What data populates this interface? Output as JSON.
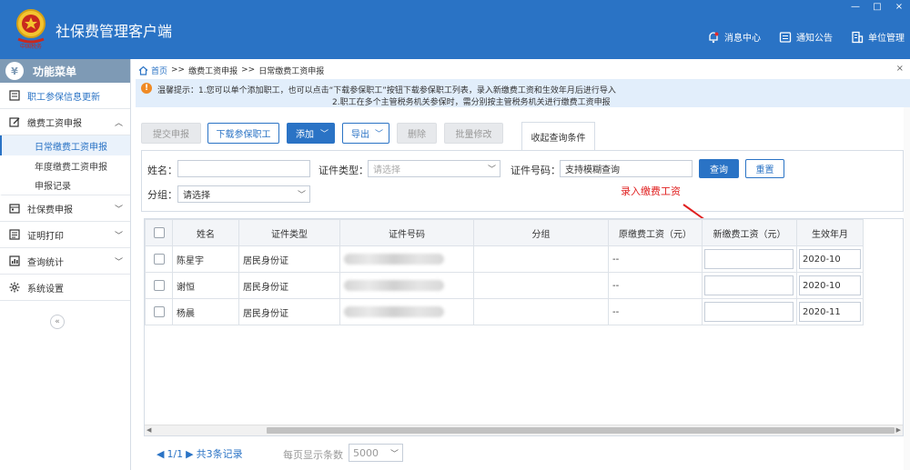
{
  "app": {
    "title": "社保费管理客户端",
    "window_controls": [
      "—",
      "□",
      "×"
    ],
    "header_menu": [
      {
        "label": "消息中心",
        "icon": "bell-icon"
      },
      {
        "label": "通知公告",
        "icon": "notice-icon"
      },
      {
        "label": "单位管理",
        "icon": "building-icon"
      }
    ]
  },
  "sidebar": {
    "title": "功能菜单",
    "title_icon": "¥",
    "items": [
      {
        "label": "职工参保信息更新",
        "icon": "list-icon"
      },
      {
        "label": "缴费工资申报",
        "icon": "edit-icon",
        "expanded": true,
        "children": [
          "日常缴费工资申报",
          "年度缴费工资申报",
          "申报记录"
        ]
      },
      {
        "label": "社保费申报",
        "icon": "calendar-icon"
      },
      {
        "label": "证明打印",
        "icon": "print-icon"
      },
      {
        "label": "查询统计",
        "icon": "chart-icon"
      },
      {
        "label": "系统设置",
        "icon": "gear-icon"
      }
    ],
    "collapse": "«"
  },
  "breadcrumb": {
    "home": "首页",
    "sep": ">>",
    "level1": "缴费工资申报",
    "level2": "日常缴费工资申报"
  },
  "tip": {
    "line1": "温馨提示：1.您可以单个添加职工，也可以点击“下载参保职工”按钮下载参保职工列表，录入新缴费工资和生效年月后进行导入",
    "line2": "2.职工在多个主管税务机关参保时，需分别按主管税务机关进行缴费工资申报"
  },
  "toolbar": {
    "submit": "提交申报",
    "download": "下载参保职工",
    "add": "添加",
    "export": "导出",
    "delete": "删除",
    "batch_edit": "批量修改",
    "toggle_query": "收起查询条件"
  },
  "search": {
    "name_label": "姓名：",
    "name_value": "",
    "idtype_label": "证件类型：",
    "idtype_placeholder": "请选择",
    "idno_label": "证件号码：",
    "idno_value": "支持模糊查询",
    "group_label": "分组：",
    "group_placeholder": "请选择",
    "query_btn": "查询",
    "reset_btn": "重置"
  },
  "annotation": "录入缴费工资",
  "accent_color": "#2a73c5",
  "table": {
    "headers": [
      "姓名",
      "证件类型",
      "证件号码",
      "分组",
      "原缴费工资（元）",
      "新缴费工资（元）",
      "生效年月"
    ],
    "rows": [
      {
        "name": "陈星宇",
        "idtype": "居民身份证",
        "group": "",
        "old_wage": "--",
        "new_wage": "",
        "effective": "2020-10"
      },
      {
        "name": "谢恒",
        "idtype": "居民身份证",
        "group": "",
        "old_wage": "--",
        "new_wage": "",
        "effective": "2020-10"
      },
      {
        "name": "杨晨",
        "idtype": "居民身份证",
        "group": "",
        "old_wage": "--",
        "new_wage": "",
        "effective": "2020-11"
      }
    ]
  },
  "pager": {
    "page": "1/1",
    "total": "共3条记录",
    "page_size_label": "每页显示条数",
    "page_size": "5000"
  }
}
